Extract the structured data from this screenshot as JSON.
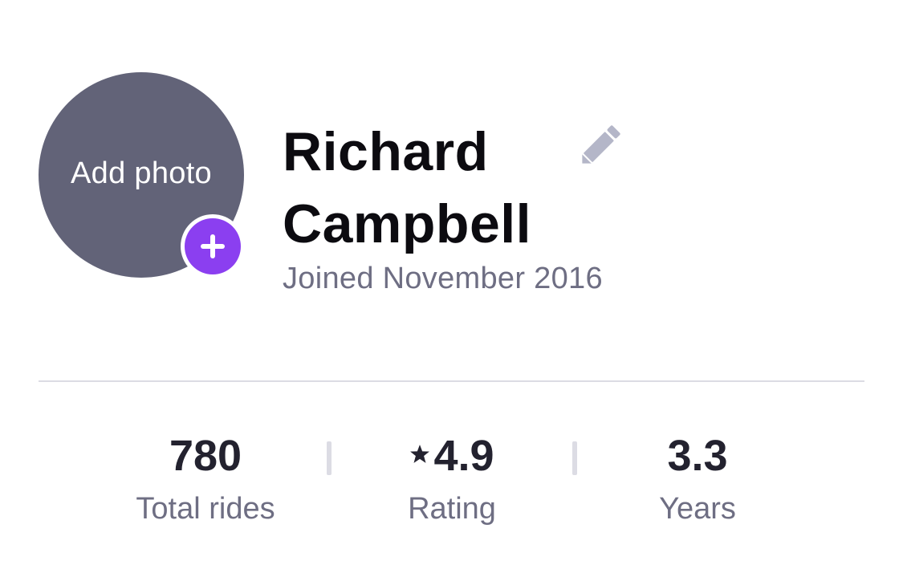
{
  "profile": {
    "add_photo_label": "Add photo",
    "first_name": "Richard",
    "last_name": "Campbell",
    "joined": "Joined November 2016"
  },
  "stats": [
    {
      "value": "780",
      "label": "Total rides"
    },
    {
      "value": "4.9",
      "label": "Rating",
      "icon": "star-icon"
    },
    {
      "value": "3.3",
      "label": "Years"
    }
  ],
  "colors": {
    "avatar_bg": "#626378",
    "accent": "#8b3ff0",
    "muted_text": "#6e6e83",
    "divider": "#dcdce4",
    "icon_gray": "#b4b6c8"
  },
  "icons": {
    "add_badge": "plus-icon",
    "edit": "pencil-icon"
  }
}
